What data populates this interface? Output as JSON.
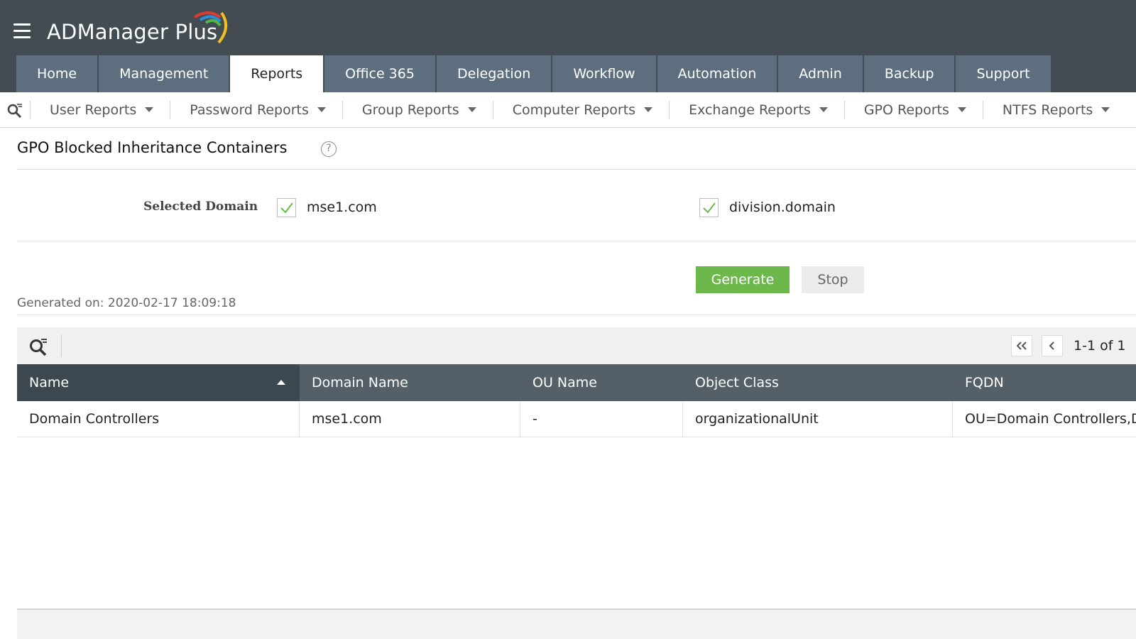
{
  "app": {
    "name": "ADManager Plus"
  },
  "main_tabs": [
    {
      "label": "Home"
    },
    {
      "label": "Management"
    },
    {
      "label": "Reports"
    },
    {
      "label": "Office 365"
    },
    {
      "label": "Delegation"
    },
    {
      "label": "Workflow"
    },
    {
      "label": "Automation"
    },
    {
      "label": "Admin"
    },
    {
      "label": "Backup"
    },
    {
      "label": "Support"
    }
  ],
  "active_tab": "Reports",
  "sub_nav": [
    {
      "label": "User Reports"
    },
    {
      "label": "Password Reports"
    },
    {
      "label": "Group Reports"
    },
    {
      "label": "Computer Reports"
    },
    {
      "label": "Exchange Reports"
    },
    {
      "label": "GPO Reports"
    },
    {
      "label": "NTFS Reports"
    }
  ],
  "page": {
    "title": "GPO Blocked Inheritance Containers",
    "help_icon": "?",
    "selected_domain_label": "Selected Domain",
    "domains": [
      {
        "name": "mse1.com",
        "checked": true
      },
      {
        "name": "division.domain",
        "checked": true
      }
    ],
    "generate_label": "Generate",
    "stop_label": "Stop",
    "generated_on": "Generated on: 2020-02-17 18:09:18"
  },
  "table": {
    "pagination": "1-1 of 1",
    "columns": [
      "Name",
      "Domain Name",
      "OU Name",
      "Object Class",
      "FQDN"
    ],
    "sorted_column": "Name",
    "sort_direction": "ascending",
    "rows": [
      [
        "Domain Controllers",
        "mse1.com",
        "-",
        "organizationalUnit",
        "OU=Domain Controllers,D"
      ]
    ]
  },
  "colors": {
    "header_bg": "#434c53",
    "tab_bg": "#5d6f7f",
    "generate_green": "#6cb84a",
    "table_header": "#555f68",
    "check_green": "#6cb84a"
  }
}
